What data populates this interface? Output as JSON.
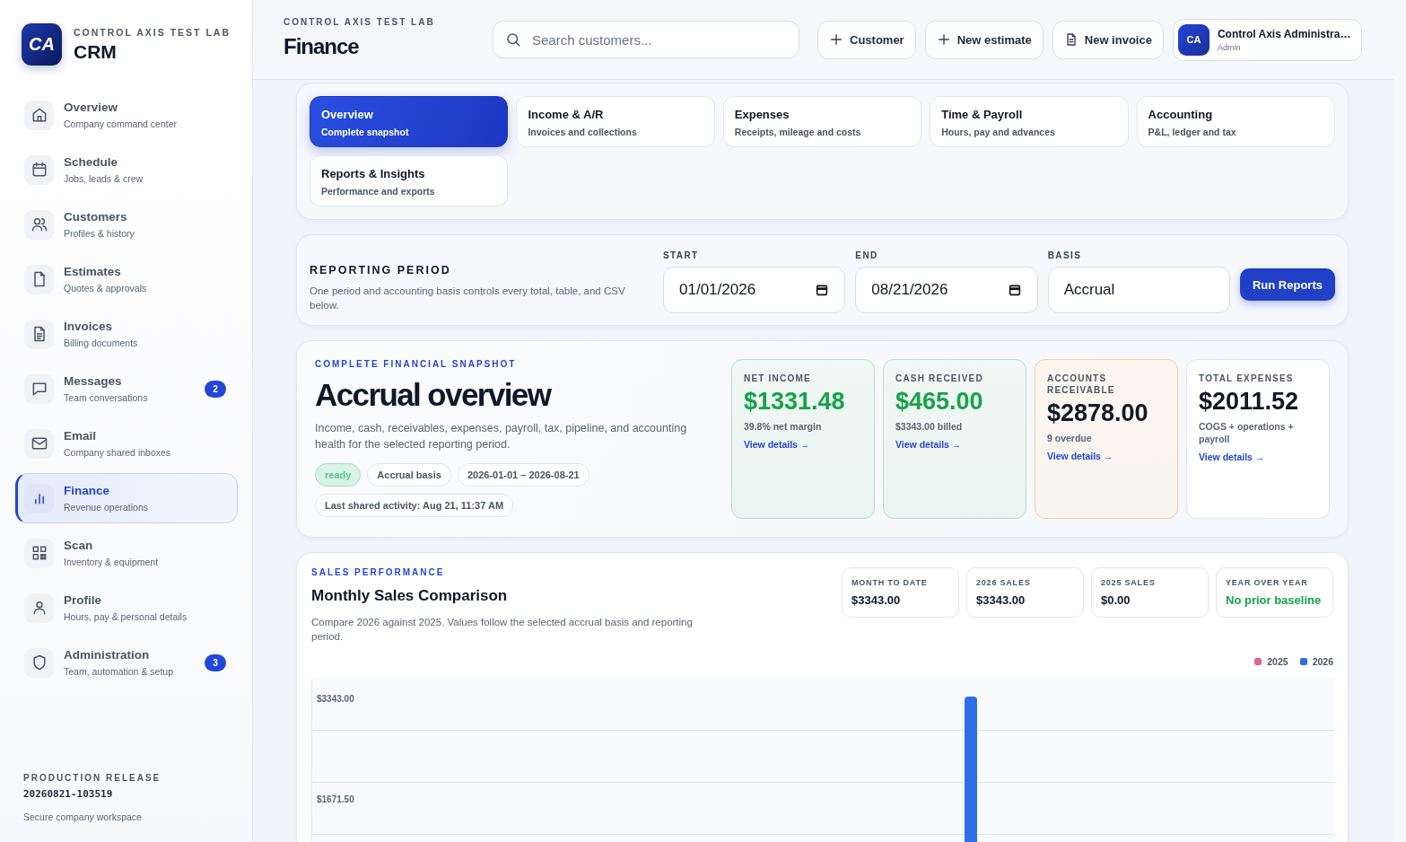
{
  "sidebar": {
    "brand": {
      "logo_text": "CA",
      "eyebrow": "CONTROL AXIS TEST LAB",
      "title": "CRM"
    },
    "items": [
      {
        "label": "Overview",
        "sub": "Company command center",
        "selected": false
      },
      {
        "label": "Schedule",
        "sub": "Jobs, leads & crew",
        "selected": false
      },
      {
        "label": "Customers",
        "sub": "Profiles & history",
        "selected": false
      },
      {
        "label": "Estimates",
        "sub": "Quotes & approvals",
        "selected": false
      },
      {
        "label": "Invoices",
        "sub": "Billing documents",
        "selected": false
      },
      {
        "label": "Messages",
        "sub": "Team conversations",
        "selected": false,
        "badge": "2"
      },
      {
        "label": "Email",
        "sub": "Company shared inboxes",
        "selected": false
      },
      {
        "label": "Finance",
        "sub": "Revenue operations",
        "selected": true
      },
      {
        "label": "Scan",
        "sub": "Inventory & equipment",
        "selected": false
      },
      {
        "label": "Profile",
        "sub": "Hours, pay & personal details",
        "selected": false
      },
      {
        "label": "Administration",
        "sub": "Team, automation & setup",
        "selected": false,
        "badge": "3"
      }
    ],
    "footer": {
      "eyebrow": "PRODUCTION RELEASE",
      "build": "20260821-103519",
      "note": "Secure company workspace"
    }
  },
  "header": {
    "eyebrow": "CONTROL AXIS TEST LAB",
    "title": "Finance",
    "search": {
      "placeholder": "Search customers..."
    },
    "buttons": [
      {
        "label": "Customer",
        "kind": "add"
      },
      {
        "label": "New estimate",
        "kind": "add"
      },
      {
        "label": "New invoice",
        "kind": "document"
      }
    ],
    "user": {
      "initials": "CA",
      "name": "Control Axis Administra…",
      "role": "Admin"
    }
  },
  "sections": [
    {
      "title": "Overview",
      "sub": "Complete snapshot",
      "selected": true
    },
    {
      "title": "Income & A/R",
      "sub": "Invoices and collections",
      "selected": false
    },
    {
      "title": "Expenses",
      "sub": "Receipts, mileage and costs",
      "selected": false
    },
    {
      "title": "Time & Payroll",
      "sub": "Hours, pay and advances",
      "selected": false
    },
    {
      "title": "Accounting",
      "sub": "P&L, ledger and tax",
      "selected": false
    },
    {
      "title": "Reports & Insights",
      "sub": "Performance and exports",
      "selected": false
    }
  ],
  "reporting_period": {
    "title": "REPORTING PERIOD",
    "description": "One period and accounting basis controls every total, table, and CSV below.",
    "fields": [
      {
        "label": "START",
        "value": "01/01/2026",
        "kind": "date"
      },
      {
        "label": "END",
        "value": "08/21/2026",
        "kind": "date"
      },
      {
        "label": "BASIS",
        "value": "Accrual",
        "kind": "text"
      }
    ],
    "button": "Run Reports"
  },
  "snapshot": {
    "eyebrow": "COMPLETE FINANCIAL SNAPSHOT",
    "title": "Accrual overview",
    "description": "Income, cash, receivables, expenses, payroll, tax, pipeline, and accounting health for the selected reporting period.",
    "chips": [
      {
        "label": "ready",
        "kind": "status"
      },
      {
        "label": "Accrual basis",
        "kind": "plain"
      },
      {
        "label": "2026-01-01 – 2026-08-21",
        "kind": "plain"
      },
      {
        "label": "Last shared activity: Aug 21, 11:37 AM",
        "kind": "plain"
      }
    ],
    "metrics": [
      {
        "label": "NET INCOME",
        "value": "$1331.48",
        "note": "39.8% net margin",
        "link": "View details →",
        "kind": "positive"
      },
      {
        "label": "CASH RECEIVED",
        "value": "$465.00",
        "note": "$3343.00 billed",
        "link": "View details →",
        "kind": "positive"
      },
      {
        "label": "ACCOUNTS RECEIVABLE",
        "value": "$2878.00",
        "note": "9 overdue",
        "link": "View details →",
        "kind": "warning"
      },
      {
        "label": "TOTAL EXPENSES",
        "value": "$2011.52",
        "note": "COGS + operations + payroll",
        "link": "View details →",
        "kind": "neutral"
      }
    ]
  },
  "sales": {
    "eyebrow": "SALES PERFORMANCE",
    "title": "Monthly Sales Comparison",
    "description": "Compare 2026 against 2025. Values follow the selected accrual basis and reporting period.",
    "stats": [
      {
        "label": "MONTH TO DATE",
        "value": "$3343.00",
        "kind": "neutral"
      },
      {
        "label": "2026 SALES",
        "value": "$3343.00",
        "kind": "neutral"
      },
      {
        "label": "2025 SALES",
        "value": "$0.00",
        "kind": "neutral"
      },
      {
        "label": "YEAR OVER YEAR",
        "value": "No prior baseline",
        "kind": "positive"
      }
    ],
    "chart_data": {
      "type": "bar",
      "ylim": [
        0,
        3343
      ],
      "yticks": [
        {
          "value": 1671.5,
          "label": "$1671.50"
        },
        {
          "value": 3343,
          "label": "$3343.00"
        }
      ],
      "series": [
        {
          "name": "2025",
          "color": "#ec5fa0",
          "values": [
            null,
            null,
            null,
            null,
            null,
            null,
            null,
            null,
            null,
            null,
            null,
            null
          ]
        },
        {
          "name": "2026",
          "color": "#2f6ee8",
          "values": [
            null,
            null,
            null,
            null,
            null,
            null,
            null,
            3343,
            null,
            null,
            null,
            null
          ]
        }
      ]
    }
  }
}
